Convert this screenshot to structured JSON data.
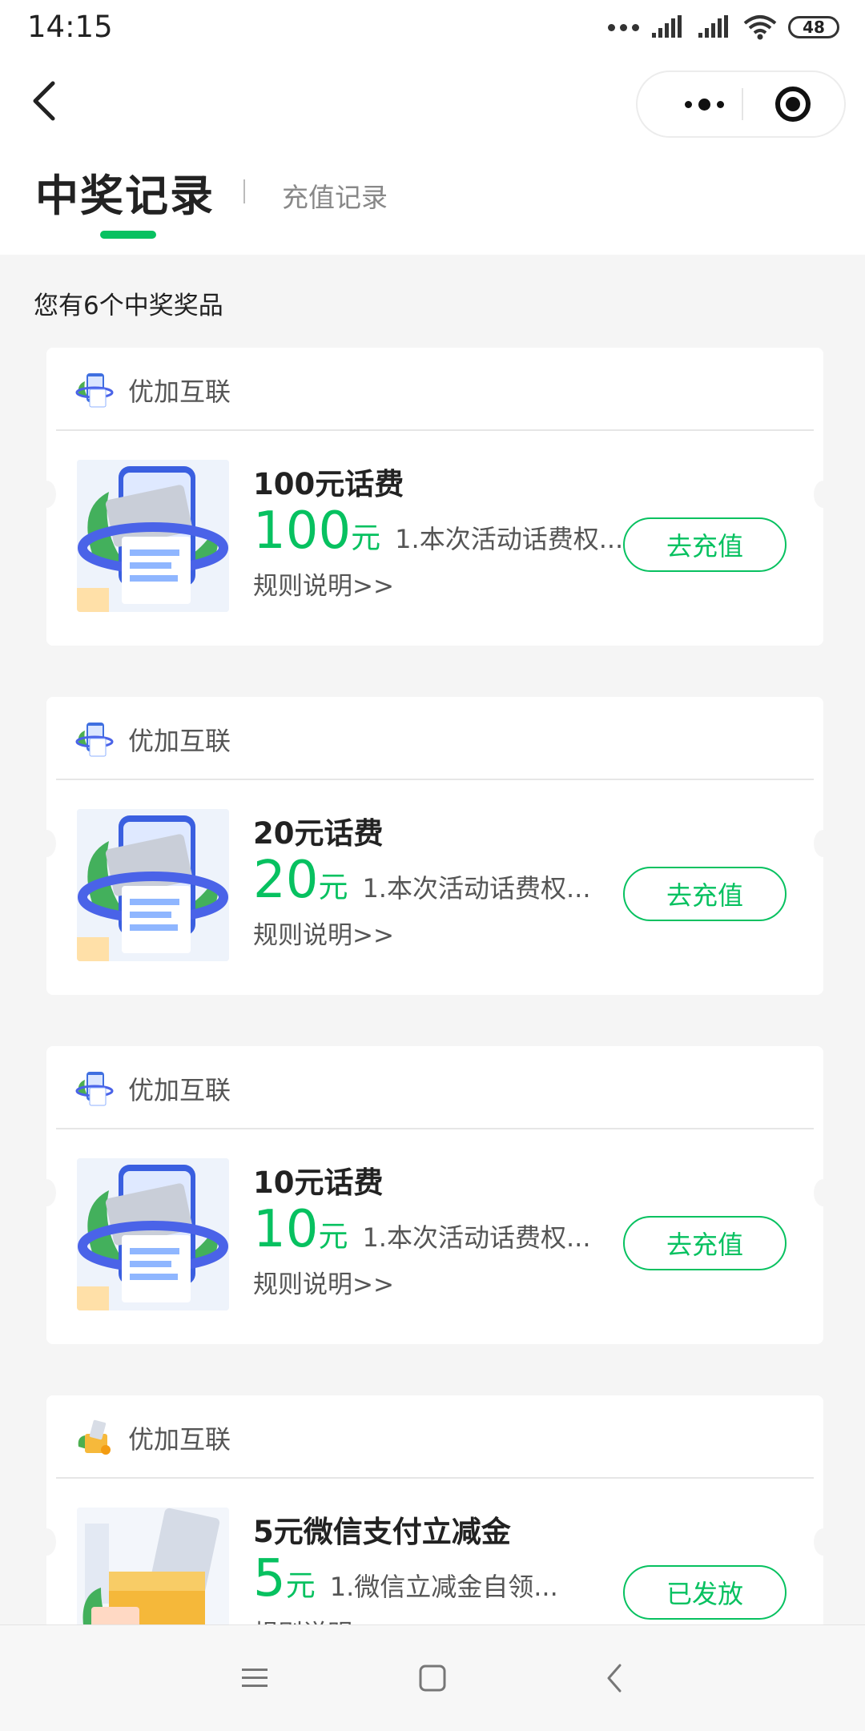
{
  "status_bar": {
    "time": "14:15",
    "battery": "48"
  },
  "nav": {
    "back_icon": "chevron-left-icon",
    "more_icon": "more-dots-icon",
    "close_icon": "target-circle-icon"
  },
  "tabs": {
    "active": "中奖记录",
    "other": "充值记录"
  },
  "summary": "您有6个中奖奖品",
  "colors": {
    "accent": "#07c160",
    "background": "#f5f5f5"
  },
  "cards": [
    {
      "merchant": "优加互联",
      "title": "100元话费",
      "amount": "100",
      "unit": "元",
      "desc": "1.本次活动话费权...",
      "rules": "规则说明>>",
      "button": "去充值",
      "image": "phone-bill-card-image"
    },
    {
      "merchant": "优加互联",
      "title": "20元话费",
      "amount": "20",
      "unit": "元",
      "desc": "1.本次活动话费权...",
      "rules": "规则说明>>",
      "button": "去充值",
      "image": "phone-bill-card-image"
    },
    {
      "merchant": "优加互联",
      "title": "10元话费",
      "amount": "10",
      "unit": "元",
      "desc": "1.本次活动话费权...",
      "rules": "规则说明>>",
      "button": "去充值",
      "image": "phone-bill-card-image"
    },
    {
      "merchant": "优加互联",
      "title": "5元微信支付立减金",
      "amount": "5",
      "unit": "元",
      "desc": "1.微信立减金自领...",
      "rules": "规则说明>>",
      "button": "已发放",
      "image": "coin-box-image"
    }
  ],
  "system_nav": {
    "menu_icon": "menu-icon",
    "home_icon": "square-home-icon",
    "back_icon": "triangle-back-icon"
  }
}
